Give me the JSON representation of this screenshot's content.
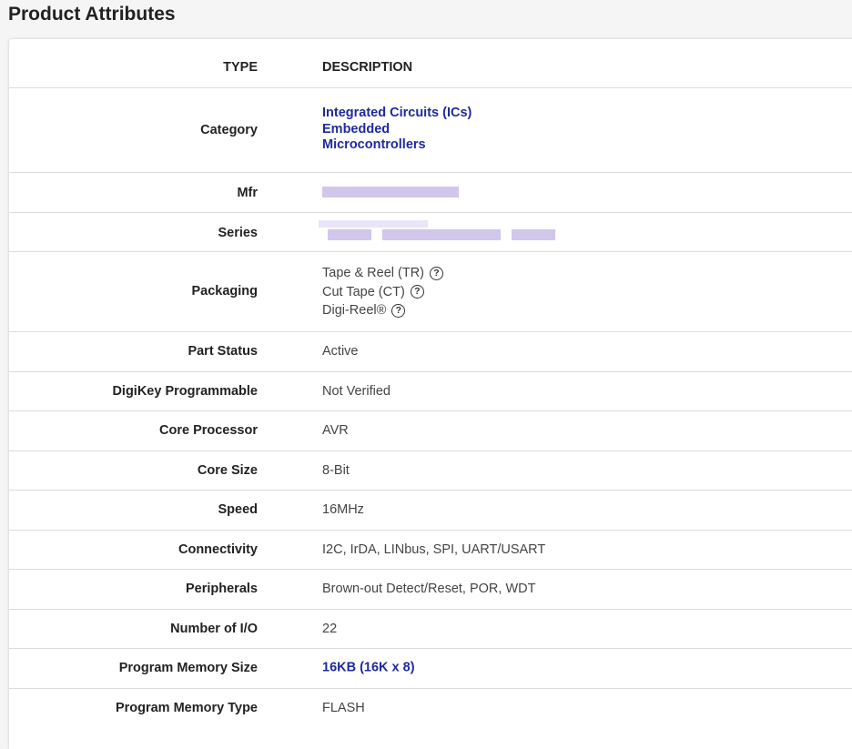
{
  "page": {
    "title": "Product Attributes"
  },
  "table": {
    "header": {
      "type": "TYPE",
      "description": "DESCRIPTION"
    },
    "category": {
      "label": "Category",
      "links": [
        "Integrated Circuits (ICs)",
        "Embedded",
        "Microcontrollers"
      ]
    },
    "mfr": {
      "label": "Mfr"
    },
    "series": {
      "label": "Series"
    },
    "packaging": {
      "label": "Packaging",
      "options": [
        "Tape & Reel (TR)",
        "Cut Tape (CT)",
        "Digi-Reel®"
      ]
    },
    "rows": [
      {
        "label": "Part Status",
        "value": "Active"
      },
      {
        "label": "DigiKey Programmable",
        "value": "Not Verified"
      },
      {
        "label": "Core Processor",
        "value": "AVR"
      },
      {
        "label": "Core Size",
        "value": "8-Bit"
      },
      {
        "label": "Speed",
        "value": "16MHz"
      },
      {
        "label": "Connectivity",
        "value": "I2C, IrDA, LINbus, SPI, UART/USART"
      },
      {
        "label": "Peripherals",
        "value": "Brown-out Detect/Reset, POR, WDT"
      },
      {
        "label": "Number of I/O",
        "value": "22"
      },
      {
        "label": "Program Memory Size",
        "value": "16KB (16K x 8)"
      },
      {
        "label": "Program Memory Type",
        "value": "FLASH"
      }
    ]
  },
  "icons": {
    "help": "question-circle-icon"
  },
  "colors": {
    "link": "#1e2a9e",
    "divider": "#dcdcdc"
  }
}
